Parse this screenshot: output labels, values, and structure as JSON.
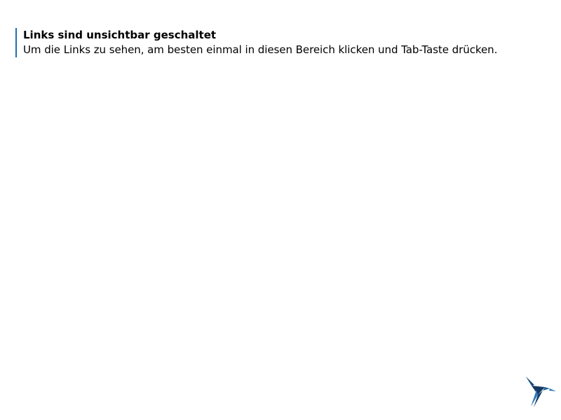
{
  "notice": {
    "title": "Links sind unsichtbar geschaltet",
    "text": "Um die Links zu sehen, am besten einmal in diesen Bereich klicken und Tab-Taste drücken."
  },
  "logo": {
    "icon": "hummingbird-icon",
    "colors": {
      "dark": "#123a63",
      "medium": "#1d5f96",
      "light": "#2c78b8"
    }
  }
}
